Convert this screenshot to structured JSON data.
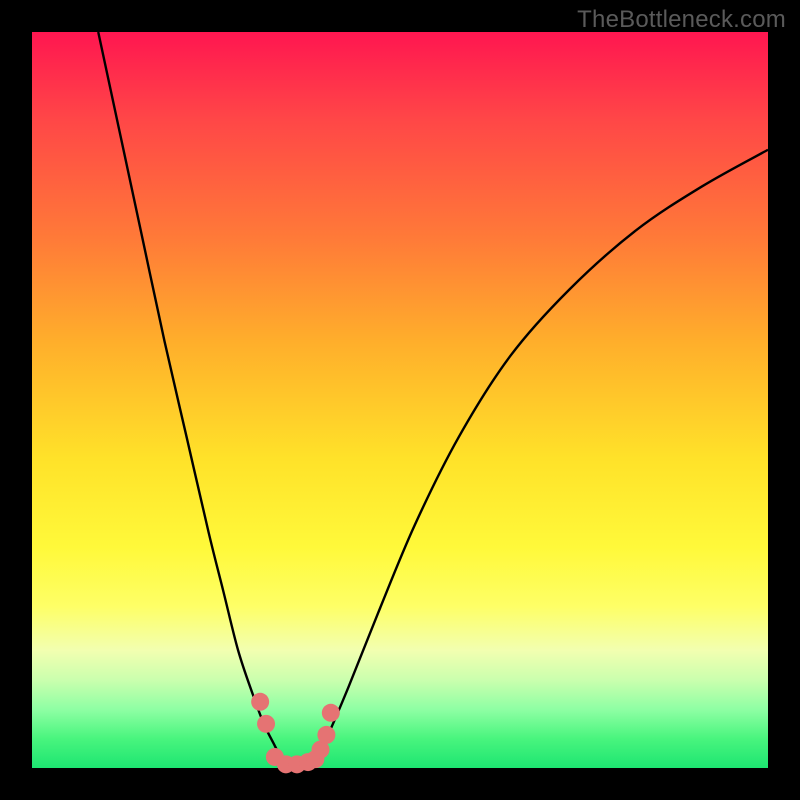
{
  "watermark": "TheBottleneck.com",
  "colors": {
    "curve": "#000000",
    "marker_fill": "#e57373",
    "marker_stroke": "#c85a5a"
  },
  "chart_data": {
    "type": "line",
    "title": "",
    "xlabel": "",
    "ylabel": "",
    "xlim": [
      0,
      100
    ],
    "ylim": [
      0,
      100
    ],
    "series": [
      {
        "name": "left-curve",
        "x": [
          9,
          12,
          15,
          18,
          21,
          24,
          26,
          28,
          30,
          31.5,
          33,
          34.5
        ],
        "values": [
          100,
          86,
          72,
          58,
          45,
          32,
          24,
          16,
          10,
          6,
          3,
          0
        ]
      },
      {
        "name": "right-curve",
        "x": [
          38,
          40,
          43,
          47,
          52,
          58,
          65,
          73,
          82,
          91,
          100
        ],
        "values": [
          0,
          4,
          11,
          21,
          33,
          45,
          56,
          65,
          73,
          79,
          84
        ]
      }
    ],
    "markers": {
      "name": "highlight-points",
      "x": [
        31,
        31.8,
        33,
        34.5,
        36,
        37.5,
        38.5,
        39.2,
        40,
        40.6
      ],
      "values": [
        9,
        6,
        1.5,
        0.5,
        0.5,
        0.8,
        1.2,
        2.5,
        4.5,
        7.5
      ]
    }
  }
}
